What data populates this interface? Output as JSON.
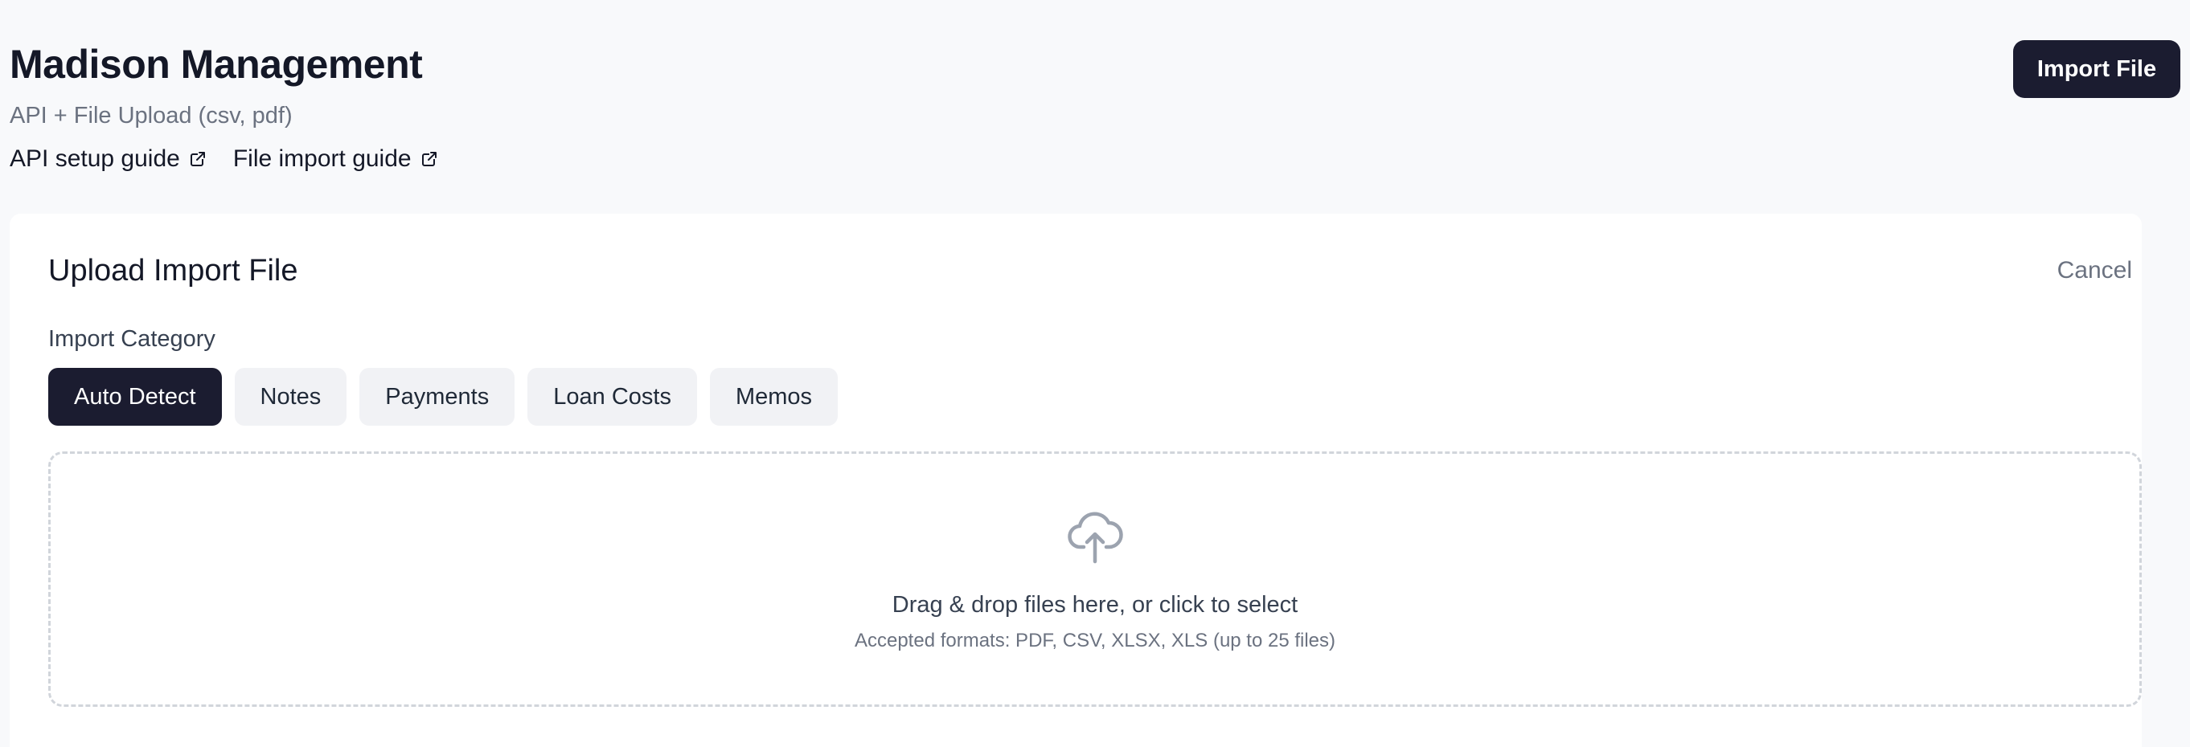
{
  "header": {
    "title": "Madison Management",
    "subtitle": "API + File Upload (csv, pdf)",
    "links": [
      {
        "label": "API setup guide",
        "icon": "external-link-icon"
      },
      {
        "label": "File import guide",
        "icon": "external-link-icon"
      }
    ],
    "import_button_label": "Import File"
  },
  "upload_card": {
    "title": "Upload Import File",
    "cancel_label": "Cancel",
    "category_label": "Import Category",
    "categories": [
      {
        "label": "Auto Detect",
        "selected": true
      },
      {
        "label": "Notes",
        "selected": false
      },
      {
        "label": "Payments",
        "selected": false
      },
      {
        "label": "Loan Costs",
        "selected": false
      },
      {
        "label": "Memos",
        "selected": false
      }
    ],
    "dropzone": {
      "icon": "cloud-upload-icon",
      "primary_text": "Drag & drop files here, or click to select",
      "secondary_text": "Accepted formats: PDF, CSV, XLSX, XLS (up to 25 files)"
    }
  },
  "colors": {
    "page_background": "#f8f9fb",
    "primary_dark": "#1b1c30",
    "chip_background": "#f1f2f5",
    "muted_text": "#6b7280"
  }
}
